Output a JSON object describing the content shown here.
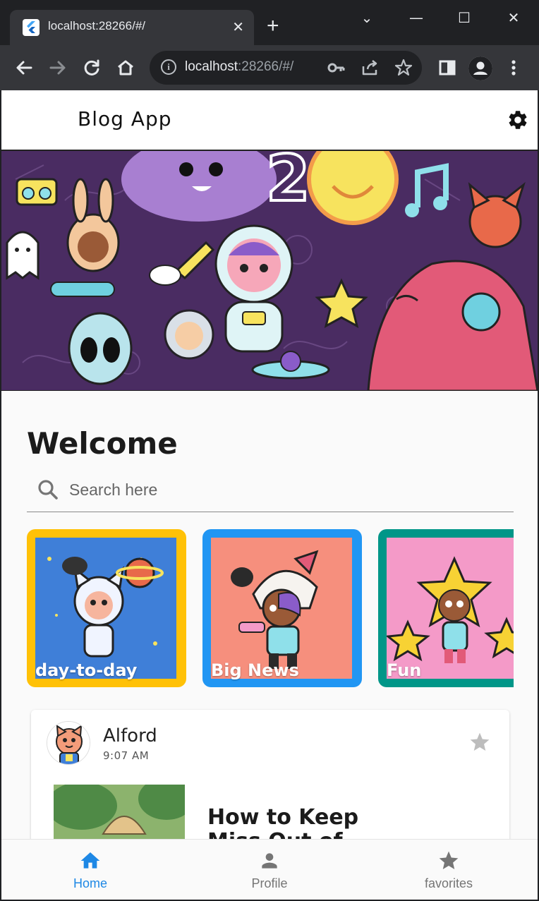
{
  "browser": {
    "tab_title": "localhost:28266/#/",
    "tab_close": "✕",
    "new_tab": "+",
    "url_host": "localhost",
    "url_path": ":28266/#/",
    "controls": {
      "minimize": "—",
      "maximize": "☐",
      "close": "✕",
      "dropdown": "⌄"
    }
  },
  "app": {
    "title": "Blog App"
  },
  "home": {
    "welcome": "Welcome",
    "search_placeholder": "Search here"
  },
  "categories": [
    {
      "label": "day-to-day",
      "border_color": "#FFC107",
      "bg_color": "#3f7fd8"
    },
    {
      "label": "Big News",
      "border_color": "#2196F3",
      "bg_color": "#f68f7d"
    },
    {
      "label": "Fun",
      "border_color": "#009688",
      "bg_color": "#f49ac8"
    }
  ],
  "post": {
    "author": "Alford",
    "time": "9:07 AM",
    "title": "How to Keep Miss Out of"
  },
  "bottom_nav": [
    {
      "label": "Home",
      "icon": "home-icon",
      "active": true
    },
    {
      "label": "Profile",
      "icon": "person-icon",
      "active": false
    },
    {
      "label": "favorites",
      "icon": "star-icon",
      "active": false
    }
  ],
  "colors": {
    "accent": "#1E88E5",
    "inactive": "#757575",
    "star_inactive": "#BDBDBD"
  }
}
